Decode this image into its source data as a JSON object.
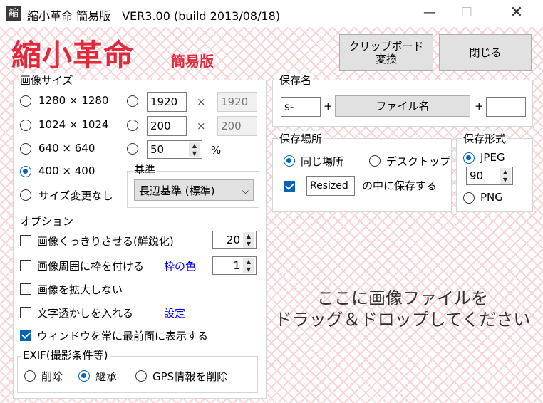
{
  "window": {
    "icon_char": "縮",
    "title": "縮小革命 簡易版　VER3.00 (build  2013/08/18)",
    "minimize_icon": "minimize-icon",
    "maximize_icon": "maximize-icon",
    "close_icon": "close-icon"
  },
  "logo": {
    "main": "縮小革命",
    "sub": "簡易版"
  },
  "buttons": {
    "clipboard": "クリップボード\n変換",
    "close": "閉じる"
  },
  "image_size": {
    "title": "画像サイズ",
    "presets": [
      "1280 × 1280",
      "1024 × 1024",
      "640 × 640",
      "400 × 400",
      "サイズ変更なし"
    ],
    "selected": "400 × 400",
    "custom1": {
      "w": "1920",
      "h": "1920",
      "x": "×"
    },
    "custom2": {
      "w": "200",
      "h": "200",
      "x": "×"
    },
    "percent": {
      "value": "50",
      "unit": "%"
    },
    "basis_title": "基準",
    "basis_value": "長辺基準 (標準)"
  },
  "options": {
    "title": "オプション",
    "sharpen": {
      "label": "画像くっきりさせる(鮮鋭化)",
      "value": "20",
      "checked": false
    },
    "frame": {
      "label": "画像周囲に枠を付ける",
      "link": "枠の色",
      "value": "1",
      "checked": false
    },
    "no_enlarge": {
      "label": "画像を拡大しない",
      "checked": false
    },
    "watermark": {
      "label": "文字透かしを入れる",
      "link": "設定",
      "checked": false
    },
    "topmost": {
      "label": "ウィンドウを常に最前面に表示する",
      "checked": true
    }
  },
  "exif": {
    "title": "EXIF(撮影条件等)",
    "choices": [
      "削除",
      "継承",
      "GPS情報を削除"
    ],
    "selected": "継承"
  },
  "save_name": {
    "title": "保存名",
    "prefix": "s-",
    "plus1": "+",
    "filename_label": "ファイル名",
    "plus2": "+",
    "suffix": ""
  },
  "save_location": {
    "title": "保存場所",
    "choices": [
      "同じ場所",
      "デスクトップ"
    ],
    "selected": "同じ場所",
    "subfolder_checked": true,
    "subfolder": "Resized",
    "subfolder_suffix": "の中に保存する"
  },
  "save_format": {
    "title": "保存形式",
    "jpeg": "JPEG",
    "quality": "90",
    "png": "PNG",
    "selected": "JPEG"
  },
  "drop_text": "ここに画像ファイルを\nドラッグ＆ドロップしてください"
}
